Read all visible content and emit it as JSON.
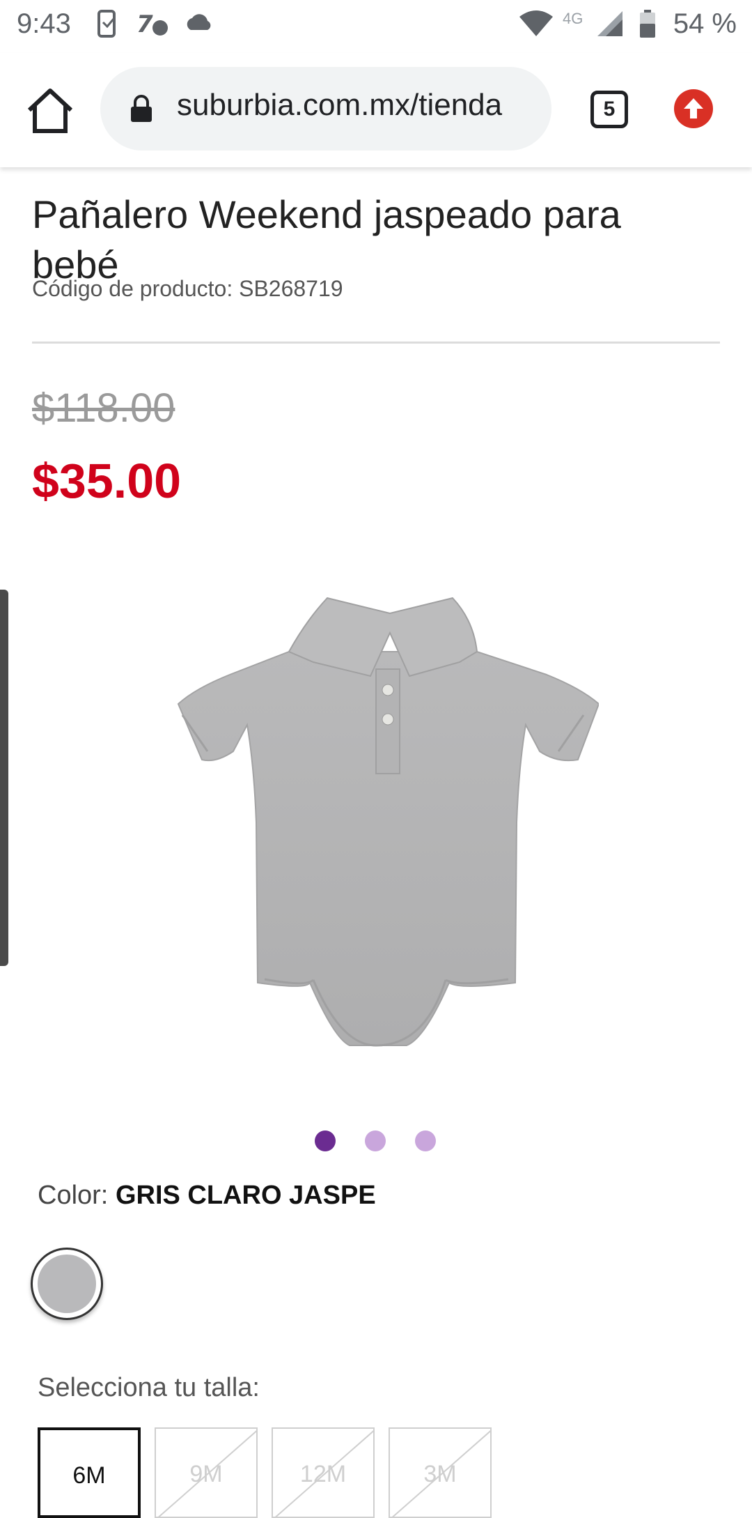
{
  "status_bar": {
    "time": "9:43",
    "network": "4G",
    "battery": "54 %"
  },
  "browser": {
    "url": "suburbia.com.mx/tienda",
    "tab_count": "5"
  },
  "product": {
    "title": "Pañalero Weekend jaspeado para bebé",
    "code_label": "Código de producto: SB268719",
    "old_price": "$118.00",
    "price": "$35.00",
    "image_count": 3,
    "active_image": 1
  },
  "color": {
    "label": "Color:",
    "value": "GRIS CLARO JASPE",
    "swatch_hex": "#b9b9bb"
  },
  "sizes": {
    "label": "Selecciona tu talla:",
    "options": [
      {
        "label": "6M",
        "available": true,
        "selected": true
      },
      {
        "label": "9M",
        "available": false,
        "selected": false
      },
      {
        "label": "12M",
        "available": false,
        "selected": false
      },
      {
        "label": "3M",
        "available": false,
        "selected": false
      }
    ]
  },
  "colors": {
    "price_red": "#d0021b",
    "dot_active": "#6b2c91",
    "dot_inactive": "#c9a6dc"
  }
}
